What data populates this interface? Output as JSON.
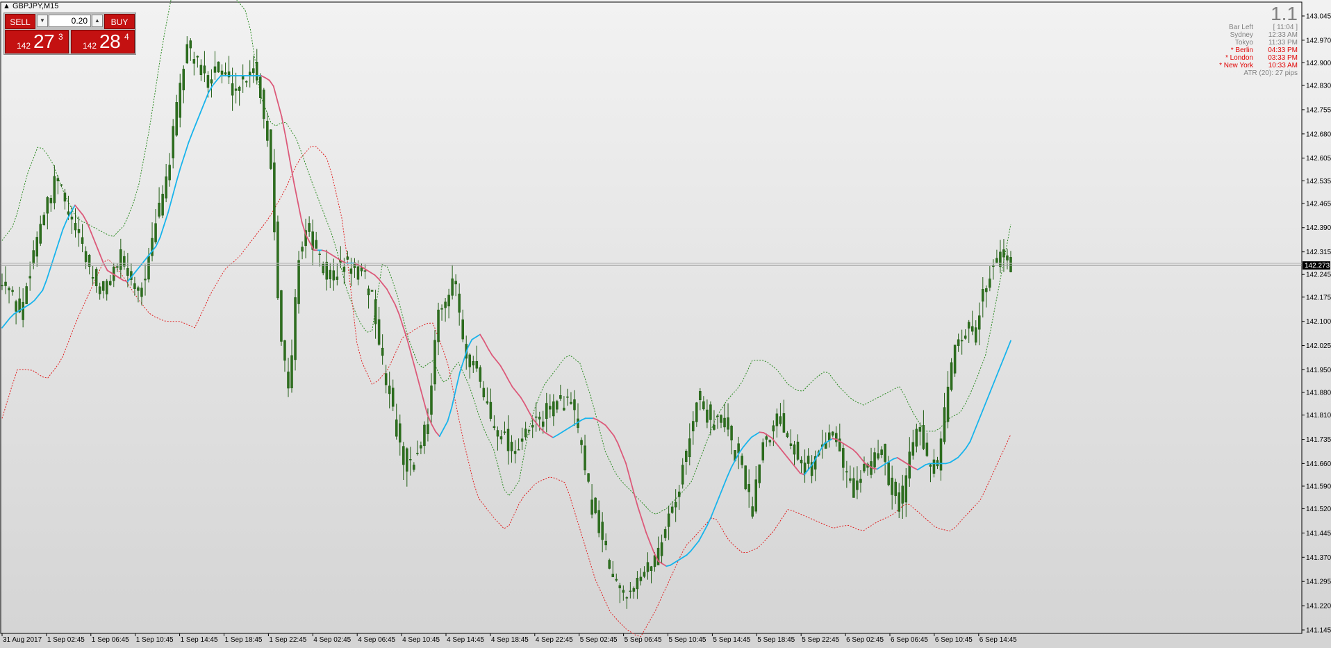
{
  "window": {
    "title": "GBPJPY,M15"
  },
  "trade_panel": {
    "sell_label": "SELL",
    "buy_label": "BUY",
    "lot_value": "0.20",
    "sell_price": {
      "big": "142",
      "pips": "27",
      "fraction": "3"
    },
    "buy_price": {
      "big": "142",
      "pips": "28",
      "fraction": "4"
    }
  },
  "info_panel": {
    "big_number": "1.1",
    "rows": [
      {
        "label": "Bar Left",
        "value": "[ 11:04 ]",
        "highlight": false
      },
      {
        "label": "Sydney",
        "value": "12:33 AM",
        "highlight": false
      },
      {
        "label": "Tokyo",
        "value": "11:33 PM",
        "highlight": false
      },
      {
        "label": "* Berlin",
        "value": "04:33 PM",
        "highlight": true
      },
      {
        "label": "* London",
        "value": "03:33 PM",
        "highlight": true
      },
      {
        "label": "* New York",
        "value": "10:33 AM",
        "highlight": true
      }
    ],
    "atr_text": "ATR (20): 27 pips"
  },
  "colors": {
    "background": "#e6e6e6",
    "candle_body": "#2d6e1e",
    "candle_wick": "#1f5c12",
    "ma_up": "#18b4ec",
    "ma_down": "#dc5a7a",
    "band_upper": "#2a8a20",
    "band_lower": "#e02020",
    "price_label_bg": "#000000"
  },
  "chart_data": {
    "type": "candlestick",
    "symbol": "GBPJPY",
    "timeframe": "M15",
    "ylim": [
      141.145,
      143.07
    ],
    "y_ticks": [
      "143.045",
      "142.970",
      "142.900",
      "142.830",
      "142.755",
      "142.680",
      "142.605",
      "142.535",
      "142.465",
      "142.390",
      "142.315",
      "142.245",
      "142.175",
      "142.100",
      "142.025",
      "141.950",
      "141.880",
      "141.810",
      "141.735",
      "141.660",
      "141.590",
      "141.520",
      "141.445",
      "141.370",
      "141.295",
      "141.220",
      "141.145"
    ],
    "x_ticks": [
      "31 Aug 2017",
      "1 Sep 02:45",
      "1 Sep 06:45",
      "1 Sep 10:45",
      "1 Sep 14:45",
      "1 Sep 18:45",
      "1 Sep 22:45",
      "4 Sep 02:45",
      "4 Sep 06:45",
      "4 Sep 10:45",
      "4 Sep 14:45",
      "4 Sep 18:45",
      "4 Sep 22:45",
      "5 Sep 02:45",
      "5 Sep 06:45",
      "5 Sep 10:45",
      "5 Sep 14:45",
      "5 Sep 18:45",
      "5 Sep 22:45",
      "6 Sep 02:45",
      "6 Sep 06:45",
      "6 Sep 10:45",
      "6 Sep 14:45"
    ],
    "current_price": "142.273",
    "grid": false,
    "close_path": [
      142.24,
      142.18,
      142.12,
      142.26,
      142.4,
      142.46,
      142.55,
      142.44,
      142.38,
      142.3,
      142.22,
      142.18,
      142.26,
      142.3,
      142.22,
      142.2,
      142.3,
      142.46,
      142.58,
      142.78,
      142.96,
      142.9,
      142.84,
      142.88,
      142.86,
      142.82,
      142.84,
      142.9,
      142.8,
      142.6,
      142.1,
      141.86,
      142.3,
      142.4,
      142.3,
      142.24,
      142.25,
      142.28,
      142.26,
      142.24,
      142.18,
      141.98,
      141.86,
      141.7,
      141.64,
      141.7,
      141.8,
      142.1,
      142.18,
      142.22,
      141.98,
      141.96,
      141.88,
      141.78,
      141.76,
      141.7,
      141.72,
      141.76,
      141.8,
      141.82,
      141.84,
      141.86,
      141.8,
      141.62,
      141.5,
      141.42,
      141.3,
      141.26,
      141.28,
      141.3,
      141.34,
      141.4,
      141.5,
      141.56,
      141.7,
      141.86,
      141.82,
      141.78,
      141.8,
      141.7,
      141.66,
      141.5,
      141.72,
      141.76,
      141.82,
      141.74,
      141.7,
      141.64,
      141.68,
      141.74,
      141.76,
      141.64,
      141.58,
      141.62,
      141.68,
      141.72,
      141.6,
      141.52,
      141.68,
      141.82,
      141.66,
      141.64,
      141.84,
      142.04,
      142.08,
      142.06,
      142.18,
      142.28,
      142.3,
      142.27
    ],
    "moving_average_path": [
      142.08,
      142.12,
      142.14,
      142.16,
      142.2,
      142.3,
      142.4,
      142.46,
      142.42,
      142.34,
      142.26,
      142.24,
      142.22,
      142.26,
      142.3,
      142.34,
      142.44,
      142.56,
      142.66,
      142.74,
      142.82,
      142.86,
      142.86,
      142.86,
      142.86,
      142.86,
      142.84,
      142.72,
      142.54,
      142.38,
      142.32,
      142.32,
      142.3,
      142.28,
      142.28,
      142.26,
      142.24,
      142.2,
      142.14,
      142.04,
      141.92,
      141.8,
      141.74,
      141.8,
      141.94,
      142.04,
      142.06,
      142.0,
      141.96,
      141.9,
      141.86,
      141.8,
      141.76,
      141.74,
      141.76,
      141.78,
      141.8,
      141.8,
      141.78,
      141.74,
      141.66,
      141.54,
      141.44,
      141.36,
      141.34,
      141.36,
      141.38,
      141.42,
      141.48,
      141.56,
      141.64,
      141.7,
      141.74,
      141.76,
      141.74,
      141.7,
      141.66,
      141.62,
      141.66,
      141.72,
      141.74,
      141.72,
      141.7,
      141.66,
      141.64,
      141.66,
      141.68,
      141.66,
      141.64,
      141.66,
      141.66,
      141.66,
      141.68,
      141.72,
      141.8,
      141.88,
      141.96,
      142.04
    ],
    "upper_band_path": [
      142.35,
      142.4,
      142.55,
      142.65,
      142.6,
      142.5,
      142.42,
      142.4,
      142.38,
      142.36,
      142.4,
      142.5,
      142.7,
      142.95,
      143.15,
      143.2,
      143.15,
      143.1,
      143.1,
      143.1,
      143.05,
      142.8,
      142.7,
      142.72,
      142.66,
      142.55,
      142.45,
      142.35,
      142.2,
      142.1,
      142.05,
      142.3,
      142.2,
      142.05,
      141.95,
      141.98,
      141.9,
      141.98,
      141.9,
      141.78,
      141.7,
      141.55,
      141.6,
      141.8,
      141.9,
      141.95,
      142.0,
      141.97,
      141.85,
      141.7,
      141.62,
      141.58,
      141.54,
      141.5,
      141.52,
      141.56,
      141.6,
      141.7,
      141.8,
      141.86,
      141.9,
      141.98,
      141.98,
      141.95,
      141.9,
      141.88,
      141.92,
      141.95,
      141.9,
      141.86,
      141.84,
      141.86,
      141.88,
      141.9,
      141.82,
      141.76,
      141.76,
      141.8,
      141.82,
      141.9,
      142.0,
      142.2,
      142.4
    ],
    "lower_band_path": [
      141.8,
      141.95,
      141.95,
      141.92,
      141.98,
      142.1,
      142.2,
      142.3,
      142.25,
      142.18,
      142.12,
      142.1,
      142.1,
      142.08,
      142.18,
      142.26,
      142.3,
      142.36,
      142.42,
      142.5,
      142.6,
      142.65,
      142.6,
      142.4,
      142.0,
      141.9,
      141.95,
      142.05,
      142.08,
      142.1,
      141.98,
      141.75,
      141.56,
      141.5,
      141.45,
      141.55,
      141.6,
      141.62,
      141.6,
      141.45,
      141.3,
      141.2,
      141.15,
      141.12,
      141.2,
      141.3,
      141.4,
      141.45,
      141.5,
      141.42,
      141.38,
      141.4,
      141.45,
      141.52,
      141.5,
      141.48,
      141.46,
      141.47,
      141.45,
      141.48,
      141.5,
      141.54,
      141.5,
      141.46,
      141.45,
      141.5,
      141.55,
      141.65,
      141.75
    ]
  }
}
